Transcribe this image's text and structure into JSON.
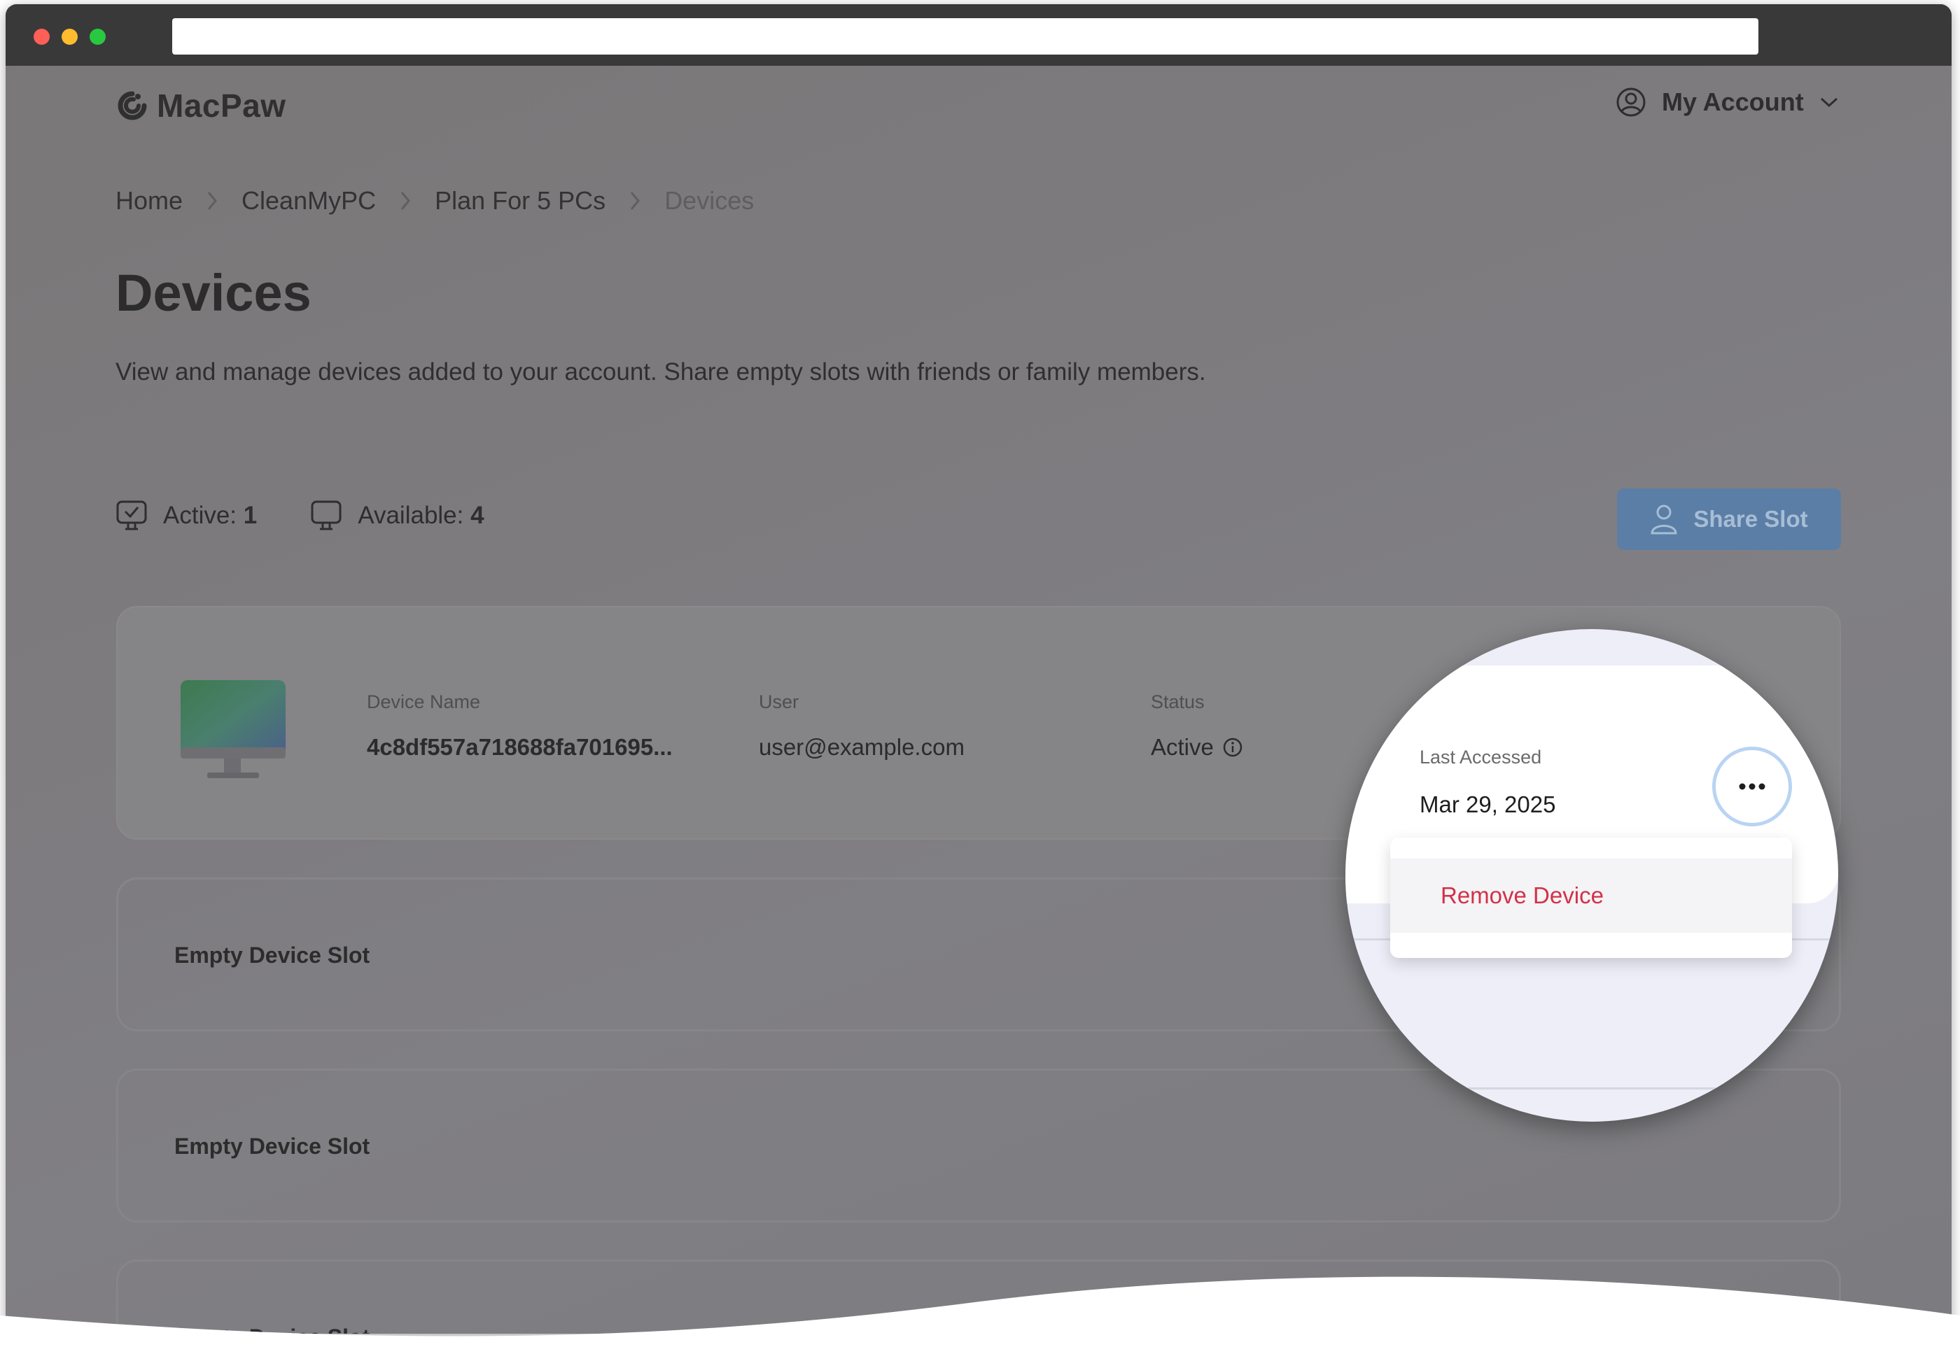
{
  "window": {
    "controls": [
      "close",
      "minimize",
      "zoom"
    ]
  },
  "header": {
    "logo_text": "MacPaw",
    "account_label": "My Account"
  },
  "breadcrumb": [
    {
      "label": "Home"
    },
    {
      "label": "CleanMyPC"
    },
    {
      "label": "Plan For 5 PCs"
    },
    {
      "label": "Devices",
      "current": true
    }
  ],
  "page": {
    "title": "Devices",
    "description": "View and manage devices added to your account. Share empty slots with friends or family members."
  },
  "stats": {
    "active_label": "Active:",
    "active_value": "1",
    "available_label": "Available:",
    "available_value": "4"
  },
  "share_button": {
    "label": "Share Slot",
    "icon": "user-icon"
  },
  "device": {
    "name_label": "Device Name",
    "name_value": "4c8df557a718688fa701695...",
    "user_label": "User",
    "user_value": "user@example.com",
    "status_label": "Status",
    "status_value": "Active",
    "last_accessed_label": "Last Accessed",
    "last_accessed_value": "Mar 29, 2025"
  },
  "menu": {
    "items": [
      {
        "label": "Remove Device"
      }
    ]
  },
  "slots": [
    {
      "label": "Empty Device Slot"
    },
    {
      "label": "Empty Device Slot"
    },
    {
      "label": "Empty Device Slot"
    }
  ],
  "colors": {
    "accent": "#5b7ea6",
    "danger": "#d23148",
    "overlay": "#7d7b7e"
  }
}
